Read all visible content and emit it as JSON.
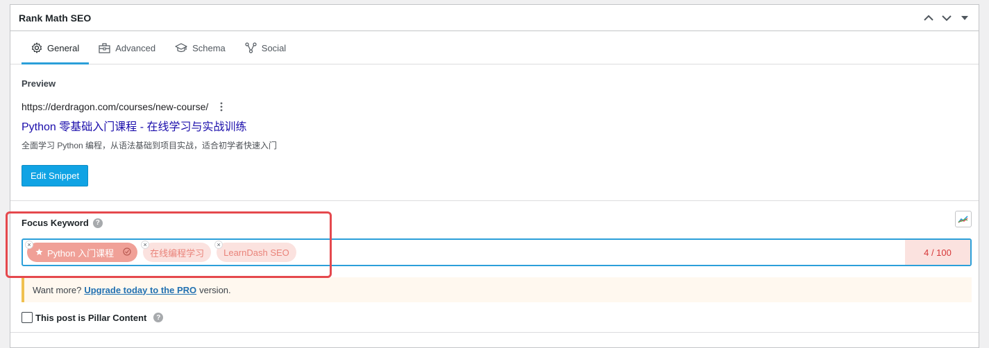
{
  "panel": {
    "title": "Rank Math SEO",
    "collapse_icon": "chevron-up-icon",
    "expand_icon": "chevron-down-icon",
    "toggle_icon": "caret-down-icon"
  },
  "tabs": [
    {
      "label": "General",
      "icon": "gear-icon",
      "active": true
    },
    {
      "label": "Advanced",
      "icon": "toolbox-icon",
      "active": false
    },
    {
      "label": "Schema",
      "icon": "graduation-cap-icon",
      "active": false
    },
    {
      "label": "Social",
      "icon": "share-nodes-icon",
      "active": false
    }
  ],
  "preview": {
    "title": "Preview",
    "url": "https://derdragon.com/courses/new-course/",
    "serp_title": "Python 零基础入门课程 - 在线学习与实战训练",
    "serp_description": "全面学习 Python 编程，从语法基础到项目实战，适合初学者快速入门",
    "edit_button": "Edit Snippet"
  },
  "focus_keyword": {
    "label": "Focus Keyword",
    "help": "?",
    "keywords": [
      {
        "text": "Python 入门课程",
        "primary": true
      },
      {
        "text": "在线编程学习",
        "primary": false
      },
      {
        "text": "LearnDash SEO",
        "primary": false
      }
    ],
    "counter": "4 / 100",
    "remove_glyph": "×"
  },
  "notice": {
    "prefix": "Want more?",
    "link": "Upgrade today to the PRO",
    "suffix": "version."
  },
  "pillar": {
    "label": "This post is Pillar Content",
    "help": "?",
    "checked": false
  },
  "colors": {
    "accent": "#2b9fd9",
    "button": "#10a3e4",
    "tag_primary": "#f0a097",
    "tag_secondary": "#fbe2df",
    "counter_text": "#d63638",
    "highlight": "#e5484d"
  }
}
